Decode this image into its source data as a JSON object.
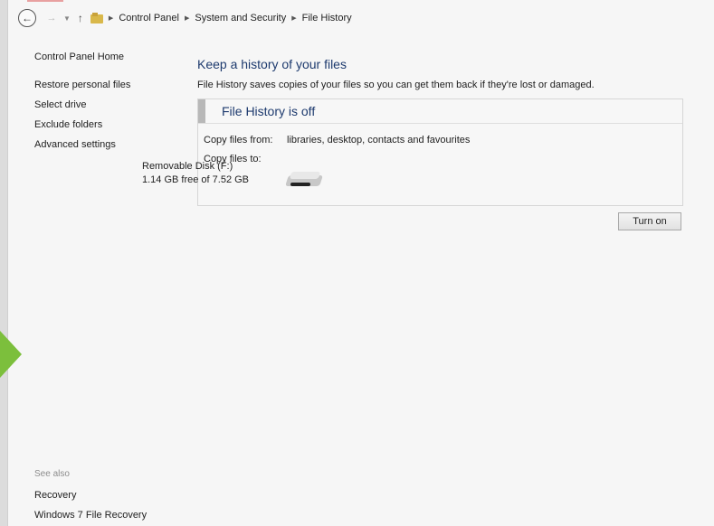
{
  "navbar": {
    "back_icon": "back-arrow-icon",
    "forward_icon": "forward-arrow-icon",
    "up_icon": "up-arrow-icon",
    "breadcrumbs": [
      "Control Panel",
      "System and Security",
      "File History"
    ]
  },
  "sidebar": {
    "items": [
      {
        "label": "Control Panel Home"
      },
      {
        "label": "Restore personal files"
      },
      {
        "label": "Select drive"
      },
      {
        "label": "Exclude folders"
      },
      {
        "label": "Advanced settings"
      }
    ]
  },
  "see_also": {
    "title": "See also",
    "links": [
      {
        "label": "Recovery"
      },
      {
        "label": "Windows 7 File Recovery"
      }
    ]
  },
  "main": {
    "title": "Keep a history of your files",
    "description": "File History saves copies of your files so you can get them back if they're lost or damaged.",
    "status": "File History is off",
    "copy_from_label": "Copy files from:",
    "copy_from_value": "libraries, desktop, contacts and favourites",
    "copy_to_label": "Copy files to:",
    "drive_name": "Removable Disk (F:)",
    "drive_free": "1.14 GB free of 7.52 GB",
    "turn_on_label": "Turn on"
  },
  "colors": {
    "heading": "#1d3a6e",
    "accent_marker": "#7cbf3c"
  }
}
